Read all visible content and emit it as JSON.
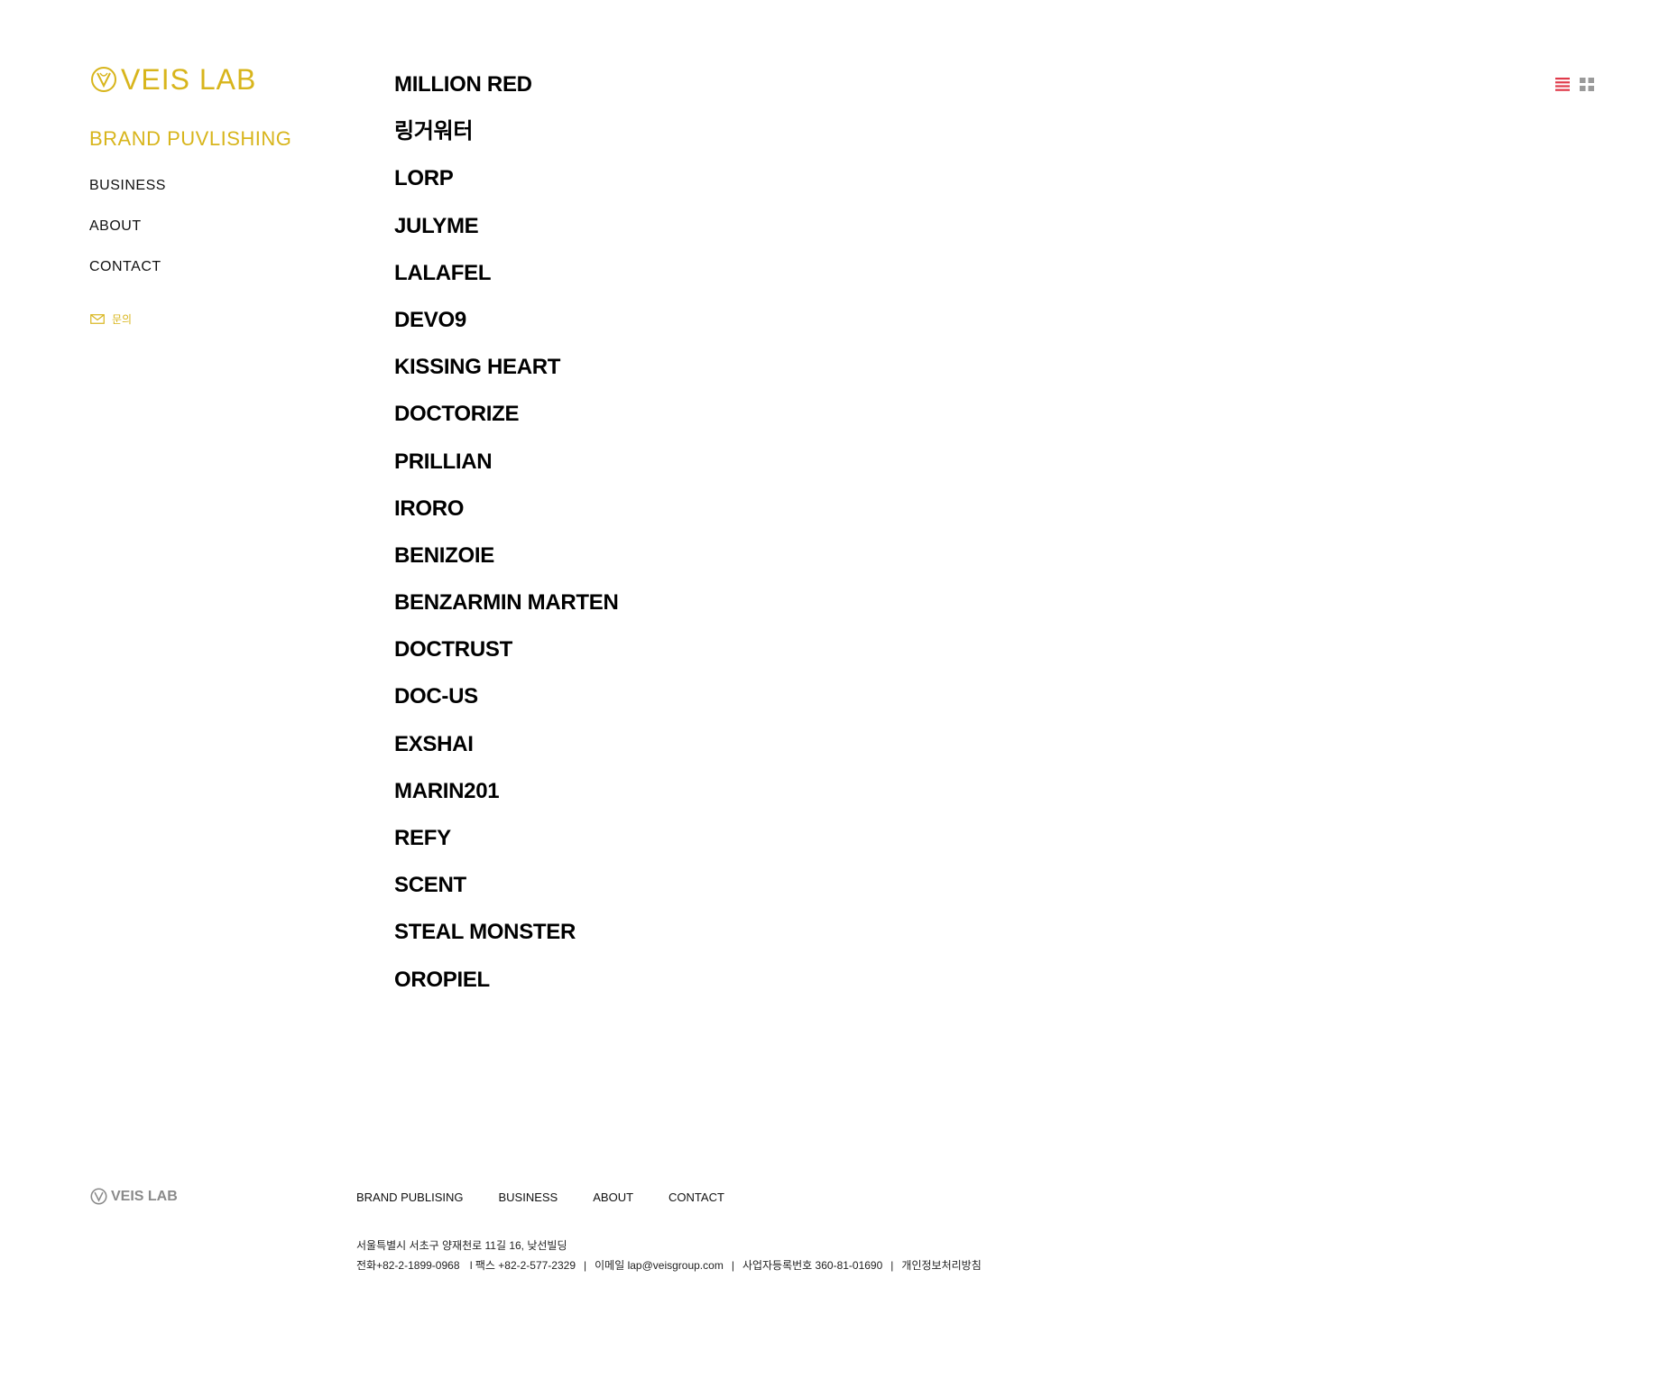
{
  "sidebar": {
    "logo_text": "VEIS LAB",
    "heading": "BRAND PUVLISHING",
    "nav": [
      {
        "label": "BUSINESS"
      },
      {
        "label": "ABOUT"
      },
      {
        "label": "CONTACT"
      }
    ],
    "inquiry_label": "문의",
    "inquiry_icon": "mail-icon"
  },
  "brands": [
    "MILLION RED",
    "링거워터",
    "LORP",
    "JULYME",
    "LALAFEL",
    "DEVO9",
    "KISSING HEART",
    "DOCTORIZE",
    "PRILLIAN",
    "IRORO",
    "BENIZOIE",
    "BENZARMIN MARTEN",
    "DOCTRUST",
    "DOC-US",
    "EXSHAI",
    "MARIN201",
    "REFY",
    "SCENT",
    "STEAL MONSTER",
    "OROPIEL"
  ],
  "view_toggles": {
    "list_icon": "list-view-icon",
    "grid_icon": "grid-view-icon",
    "active": "list"
  },
  "footer": {
    "logo_text": "VEIS LAB",
    "nav": [
      {
        "label": "BRAND PUBLISING"
      },
      {
        "label": "BUSINESS"
      },
      {
        "label": "ABOUT"
      },
      {
        "label": "CONTACT"
      }
    ],
    "address": "서울특별시 서초구 양재천로 11길 16, 낮선빌딩",
    "phone": "전화+82-2-1899-0968",
    "fax": "l 팩스 +82-2-577-2329",
    "email": "이메일 lap@veisgroup.com",
    "business_no": "사업자등록번호 360-81-01690",
    "privacy": "개인정보처리방침"
  },
  "colors": {
    "accent": "#d8b51c",
    "active_toggle": "#e03a4a",
    "inactive_toggle": "#9a9a9a",
    "footer_logo": "#8a8a8a"
  }
}
